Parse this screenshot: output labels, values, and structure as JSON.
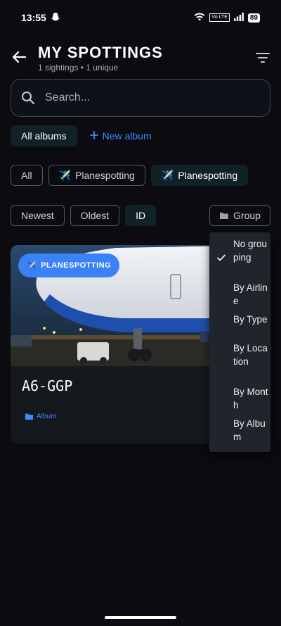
{
  "status": {
    "time": "13:55",
    "lte": "Vo LTE",
    "battery": "89"
  },
  "header": {
    "title": "MY SPOTTINGS",
    "subtitle": "1 sightings • 1 unique"
  },
  "search": {
    "placeholder": "Search..."
  },
  "albums": {
    "all_label": "All albums",
    "new_label": "New album"
  },
  "categories": [
    {
      "label": "All"
    },
    {
      "icon": "✈️",
      "label": "Planespotting"
    },
    {
      "icon": "✈️",
      "label": "Planespotting"
    }
  ],
  "sort": {
    "newest": "Newest",
    "oldest": "Oldest",
    "id": "ID"
  },
  "group": {
    "label": "Group"
  },
  "card": {
    "badge_icon": "✈️",
    "badge": "PLANESPOTTING",
    "registration": "A6-GGP",
    "album": "Album"
  },
  "group_menu": {
    "selected": "No grouping",
    "items": [
      {
        "label": "No grouping"
      },
      {
        "label": "By Airline"
      },
      {
        "label": "By Type"
      },
      {
        "label": "By Location"
      },
      {
        "label": "By Month"
      },
      {
        "label": "By Album"
      }
    ]
  },
  "colors": {
    "accent": "#3d8bff",
    "badge": "#3b82f6",
    "chip_active": "#102227",
    "background": "#0b0b10"
  }
}
